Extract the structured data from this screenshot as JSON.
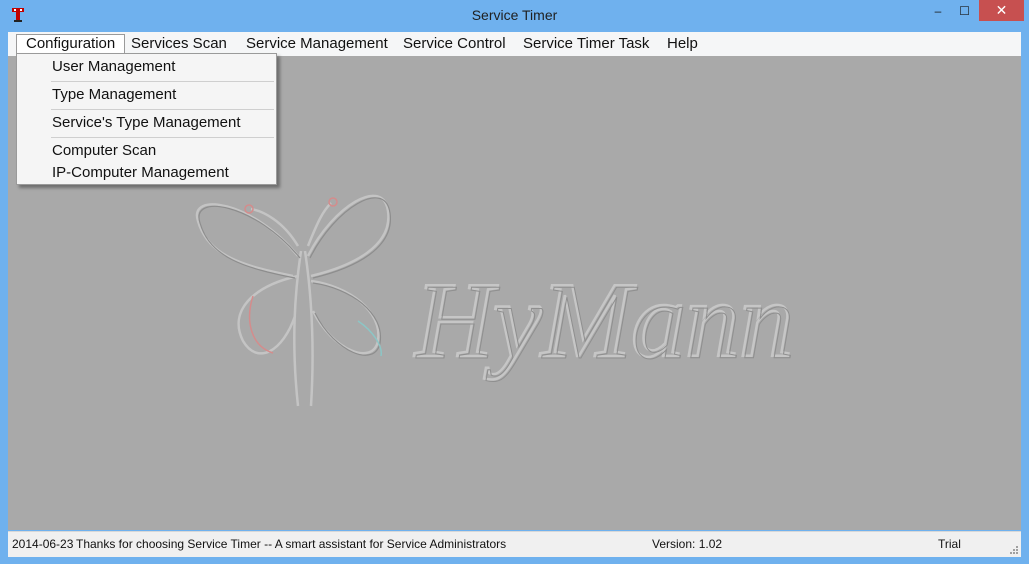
{
  "window": {
    "title": "Service Timer"
  },
  "window_controls": {
    "minimize": "–",
    "maximize": "☐",
    "close": "✕"
  },
  "menubar": {
    "items": [
      {
        "label": "Configuration"
      },
      {
        "label": "Services Scan"
      },
      {
        "label": "Service Management"
      },
      {
        "label": "Service Control"
      },
      {
        "label": "Service Timer Task"
      },
      {
        "label": "Help"
      }
    ]
  },
  "dropdown": {
    "items": [
      {
        "label": "User Management"
      },
      {
        "label": "Type Management"
      },
      {
        "label": "Service's Type Management"
      },
      {
        "label": "Computer Scan"
      },
      {
        "label": "IP-Computer Management"
      }
    ]
  },
  "watermark": {
    "text": "HyMann"
  },
  "statusbar": {
    "date": "2014-06-23",
    "message": "Thanks for choosing Service Timer -- A smart assistant for Service Administrators",
    "version": "Version: 1.02",
    "license": "Trial"
  },
  "colors": {
    "frame": "#6fb1ee",
    "client": "#a9a9a9",
    "close_button": "#c75050",
    "icon": "#c00000"
  },
  "icons": [
    "app-icon",
    "minimize-icon",
    "maximize-icon",
    "close-icon",
    "resize-grip-icon",
    "butterfly-logo-icon"
  ]
}
